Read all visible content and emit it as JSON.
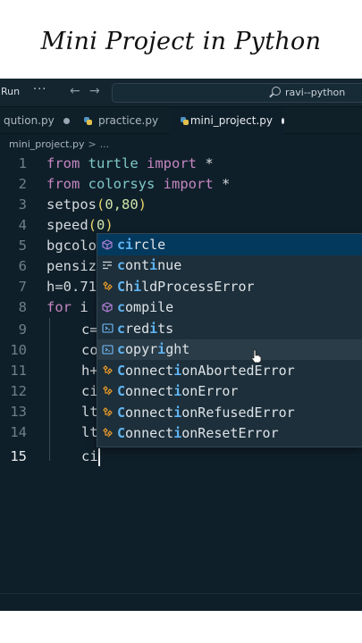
{
  "banner": {
    "title": "Mini Project in Python"
  },
  "titlebar": {
    "run_label": "Run",
    "more_label": "···",
    "back_arrow": "←",
    "forward_arrow": "→",
    "search_text": "ravi--python"
  },
  "tabs": [
    {
      "label": "qution.py",
      "modified": true,
      "active": false
    },
    {
      "label": "practice.py",
      "modified": false,
      "active": false
    },
    {
      "label": "mini_project.py",
      "modified": true,
      "active": true
    }
  ],
  "breadcrumb": {
    "file": "mini_project.py",
    "separator": ">",
    "rest": "..."
  },
  "code_lines": [
    {
      "n": "1"
    },
    {
      "n": "2"
    },
    {
      "n": "3"
    },
    {
      "n": "4"
    },
    {
      "n": "5"
    },
    {
      "n": "6"
    },
    {
      "n": "7"
    },
    {
      "n": "8"
    },
    {
      "n": "9"
    },
    {
      "n": "10"
    },
    {
      "n": "11"
    },
    {
      "n": "12"
    },
    {
      "n": "13"
    },
    {
      "n": "14"
    },
    {
      "n": "15"
    }
  ],
  "code": {
    "l1": {
      "kw1": "from",
      "mod": "turtle",
      "kw2": "import",
      "rest": "*"
    },
    "l2": {
      "kw1": "from",
      "mod": "colorsys",
      "kw2": "import",
      "rest": "*"
    },
    "l3": {
      "fn": "setpos",
      "open": "(",
      "args": "0,80",
      "close": ")"
    },
    "l4": {
      "fn": "speed",
      "open": "(",
      "args": "0",
      "close": ")"
    },
    "l5": {
      "text": "bgcolo"
    },
    "l6": {
      "text": "pensiz"
    },
    "l7": {
      "text": "h=0.71"
    },
    "l8": {
      "kw": "for",
      "rest": "i"
    },
    "l9": {
      "text": "c="
    },
    "l10": {
      "text": "co"
    },
    "l11": {
      "text": "h+"
    },
    "l12": {
      "text": "ci"
    },
    "l13": {
      "text": "lt"
    },
    "l14": {
      "text": "lt"
    },
    "l15": {
      "text": "ci"
    }
  },
  "suggestions": [
    {
      "icon": "function-cube-icon",
      "pre": "",
      "m1": "ci",
      "mid": "",
      "m2": "",
      "post": "rcle",
      "state": "selected"
    },
    {
      "icon": "keyword-icon",
      "pre": "",
      "m1": "c",
      "mid": "ont",
      "m2": "i",
      "post": "nue",
      "state": ""
    },
    {
      "icon": "class-icon",
      "pre": "",
      "m1": "C",
      "mid": "h",
      "m2": "i",
      "post": "ldProcessError",
      "state": ""
    },
    {
      "icon": "function-cube-icon",
      "pre": "",
      "m1": "c",
      "mid": "ompile",
      "m2": "",
      "post": "",
      "state": ""
    },
    {
      "icon": "variable-icon",
      "pre": "",
      "m1": "c",
      "mid": "red",
      "m2": "i",
      "post": "ts",
      "state": ""
    },
    {
      "icon": "variable-icon",
      "pre": "",
      "m1": "c",
      "mid": "opyr",
      "m2": "i",
      "post": "ght",
      "state": "hover"
    },
    {
      "icon": "class-icon",
      "pre": "",
      "m1": "C",
      "mid": "onnect",
      "m2": "i",
      "post": "onAbortedError",
      "state": ""
    },
    {
      "icon": "class-icon",
      "pre": "",
      "m1": "C",
      "mid": "onnect",
      "m2": "i",
      "post": "onError",
      "state": ""
    },
    {
      "icon": "class-icon",
      "pre": "",
      "m1": "C",
      "mid": "onnect",
      "m2": "i",
      "post": "onRefusedError",
      "state": ""
    },
    {
      "icon": "class-icon",
      "pre": "",
      "m1": "C",
      "mid": "onnect",
      "m2": "i",
      "post": "onResetError",
      "state": ""
    }
  ],
  "colors": {
    "editor_bg": "#0f1f2a",
    "keyword": "#c586c0",
    "module": "#7fc8c6",
    "match_highlight": "#5fb4f2",
    "selected_row": "#04395e"
  }
}
